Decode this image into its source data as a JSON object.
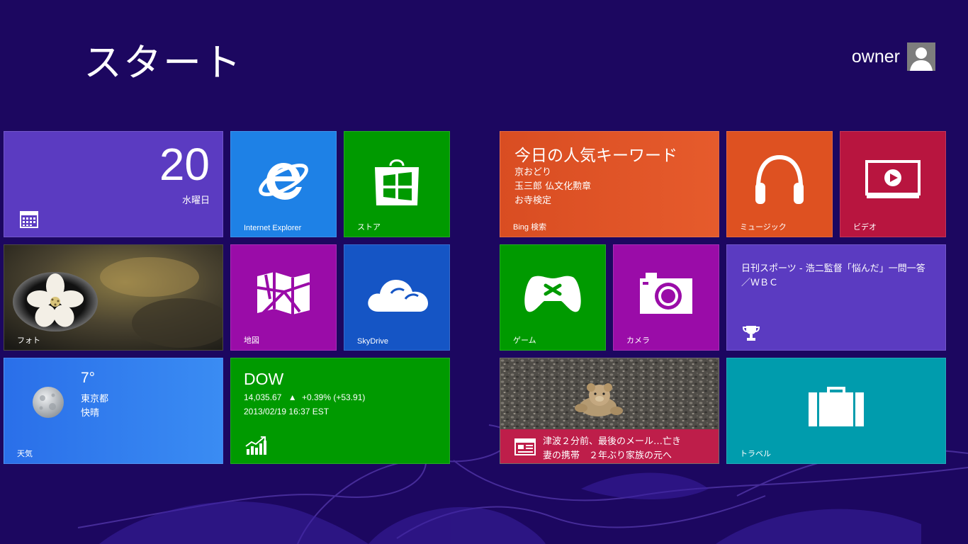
{
  "screen": {
    "title": "スタート",
    "background_color": "#1c0760",
    "user": {
      "name": "owner",
      "avatar_icon": "user-silhouette-icon"
    }
  },
  "tiles": {
    "calendar": {
      "day": "20",
      "weekday": "水曜日",
      "icon": "calendar-grid-icon",
      "color": "#5b3bc1"
    },
    "internet_explorer": {
      "label": "Internet Explorer",
      "icon": "ie-logo-icon",
      "color": "#1e81e6"
    },
    "store": {
      "label": "ストア",
      "icon": "store-bag-icon",
      "color": "#009a00"
    },
    "bing": {
      "header": "今日の人気キーワード",
      "items": [
        "京おどり",
        "玉三郎 仏文化勲章",
        "お寺検定"
      ],
      "label": "Bing 検索",
      "color": "#de5121"
    },
    "music": {
      "label": "ミュージック",
      "icon": "headphones-icon",
      "color": "#de5121"
    },
    "video": {
      "label": "ビデオ",
      "icon": "video-play-icon",
      "color": "#b8153f"
    },
    "photos": {
      "label": "フォト"
    },
    "maps": {
      "label": "地図",
      "icon": "map-icon",
      "color": "#9a0ca8"
    },
    "skydrive": {
      "label": "SkyDrive",
      "icon": "cloud-icon",
      "color": "#1555c5"
    },
    "games": {
      "label": "ゲーム",
      "icon": "gamepad-icon",
      "color": "#009a00"
    },
    "camera": {
      "label": "カメラ",
      "icon": "camera-icon",
      "color": "#9a0ca8"
    },
    "sports": {
      "headline": "日刊スポーツ - 浩二監督「悩んだ」一問一答／ＷＢＣ",
      "icon": "trophy-icon",
      "color": "#5b3bc1"
    },
    "weather": {
      "temperature": "7°",
      "city": "東京都",
      "condition": "快晴",
      "label": "天気",
      "icon": "moon-icon",
      "color": "#2b7ff0"
    },
    "finance": {
      "index": "DOW",
      "value": "14,035.67",
      "arrow": "▲",
      "change": "+0.39% (+53.91)",
      "timestamp": "2013/02/19 16:37 EST",
      "icon": "stock-chart-icon",
      "color": "#009a00"
    },
    "news": {
      "line1": "津波２分前、最後のメール…亡き",
      "line2": "妻の携帯　２年ぶり家族の元へ",
      "icon": "newspaper-icon",
      "bar_color": "#be1e4a"
    },
    "travel": {
      "label": "トラベル",
      "icon": "suitcase-icon",
      "color": "#009cad"
    }
  }
}
